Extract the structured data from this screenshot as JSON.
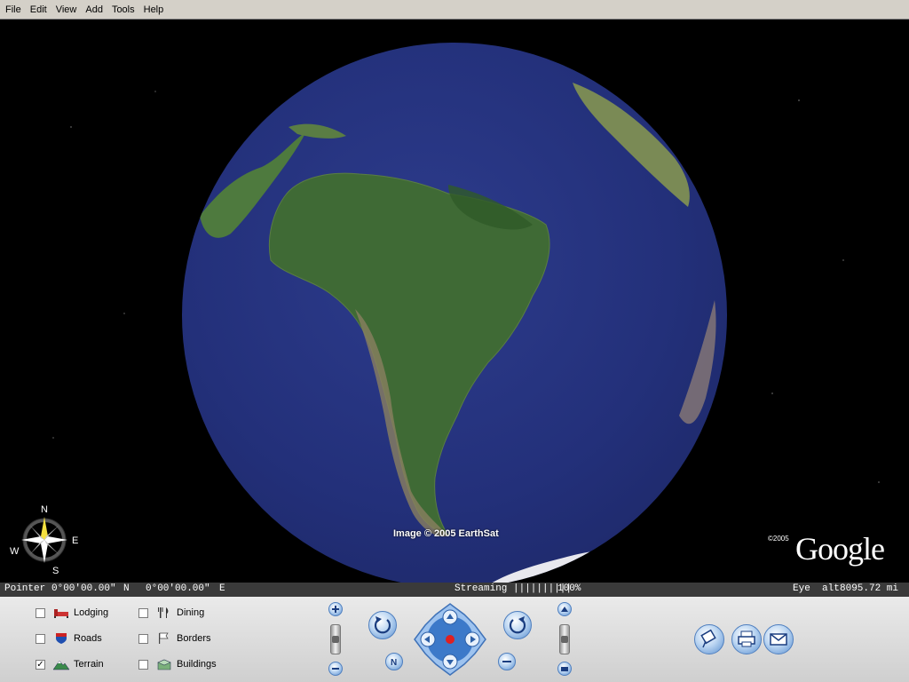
{
  "menu": [
    "File",
    "Edit",
    "View",
    "Add",
    "Tools",
    "Help"
  ],
  "viewport": {
    "attribution": "Image © 2005 EarthSat",
    "copyright": "©2005",
    "logo": "Google",
    "compass": {
      "n": "N",
      "e": "E",
      "s": "S",
      "w": "W"
    }
  },
  "status": {
    "pointer_label": "Pointer",
    "lat": "0°00'00.00\"",
    "lat_dir": "N",
    "lon": "0°00'00.00\"",
    "lon_dir": "E",
    "streaming_label": "Streaming",
    "streaming_bar": "||||||||||",
    "streaming_pct": "100%",
    "eye_alt_label": "Eye  alt",
    "eye_alt_value": "8095.72 mi"
  },
  "layers": [
    {
      "label": "Lodging",
      "checked": false,
      "icon": "bed-icon"
    },
    {
      "label": "Roads",
      "checked": false,
      "icon": "road-shield-icon"
    },
    {
      "label": "Terrain",
      "checked": true,
      "icon": "mountain-icon"
    },
    {
      "label": "Dining",
      "checked": false,
      "icon": "fork-knife-icon"
    },
    {
      "label": "Borders",
      "checked": false,
      "icon": "flag-icon"
    },
    {
      "label": "Buildings",
      "checked": false,
      "icon": "building-icon"
    }
  ],
  "colors": {
    "accent": "#5a8fd0",
    "background": "#000000",
    "ocean": "#23307a",
    "atmosphere": "#7a64ff"
  }
}
